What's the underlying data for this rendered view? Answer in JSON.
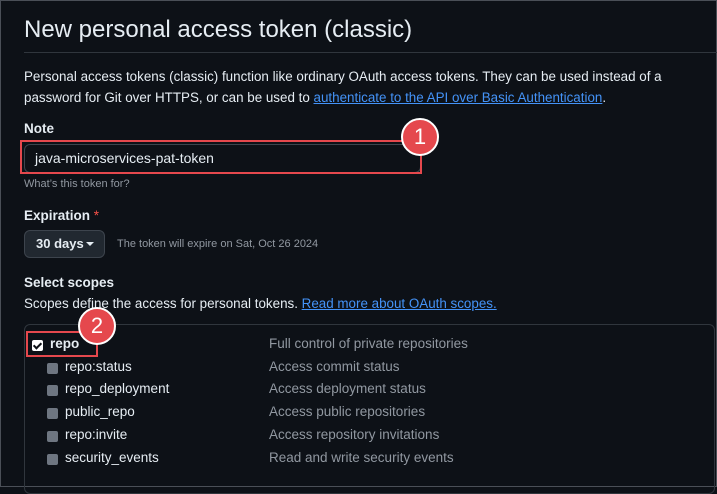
{
  "header": {
    "title": "New personal access token (classic)"
  },
  "intro": {
    "text": "Personal access tokens (classic) function like ordinary OAuth access tokens. They can be used instead of a password for Git over HTTPS, or can be used to ",
    "link": "authenticate to the API over Basic Authentication",
    "end": "."
  },
  "note": {
    "label": "Note",
    "value": "java-microservices-pat-token",
    "hint": "What’s this token for?"
  },
  "expiration": {
    "label": "Expiration",
    "required_mark": "*",
    "selected": "30 days",
    "note": "The token will expire on Sat, Oct 26 2024"
  },
  "scopes": {
    "label": "Select scopes",
    "text": "Scopes define the access for personal tokens. ",
    "link": "Read more about OAuth scopes.",
    "items": [
      {
        "name": "repo",
        "desc": "Full control of private repositories",
        "checked": true
      },
      {
        "name": "repo:status",
        "desc": "Access commit status",
        "checked": false
      },
      {
        "name": "repo_deployment",
        "desc": "Access deployment status",
        "checked": false
      },
      {
        "name": "public_repo",
        "desc": "Access public repositories",
        "checked": false
      },
      {
        "name": "repo:invite",
        "desc": "Access repository invitations",
        "checked": false
      },
      {
        "name": "security_events",
        "desc": "Read and write security events",
        "checked": false
      }
    ]
  },
  "annotations": {
    "badge1": "1",
    "badge2": "2",
    "highlight_color": "#e5484d"
  },
  "colors": {
    "background": "#0d1117",
    "link": "#4493f8",
    "muted": "#9198a1"
  }
}
